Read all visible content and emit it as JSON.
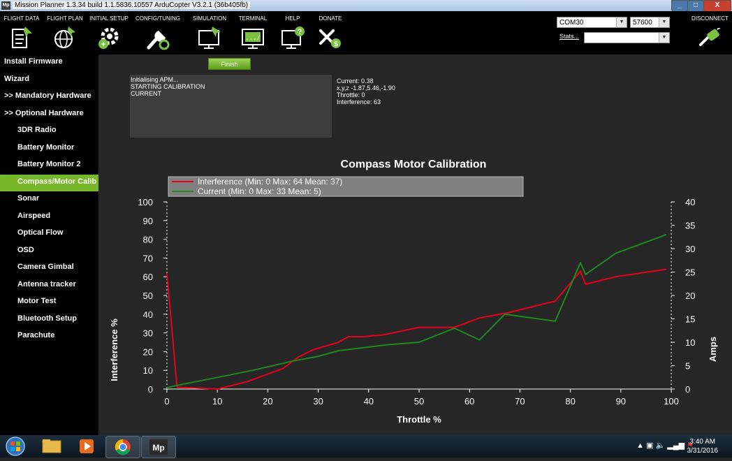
{
  "window": {
    "title": "Mission Planner 1.3.34 build 1.1.5836.10557 ArduCopter V3.2.1 (36b405fb)",
    "app_icon": "Mp"
  },
  "toolbar": {
    "items": [
      {
        "label": "FLIGHT DATA",
        "icon": "flight-data-icon"
      },
      {
        "label": "FLIGHT PLAN",
        "icon": "flight-plan-icon"
      },
      {
        "label": "INITIAL SETUP",
        "icon": "initial-setup-icon"
      },
      {
        "label": "CONFIG/TUNING",
        "icon": "config-tuning-icon"
      },
      {
        "label": "SIMULATION",
        "icon": "simulation-icon"
      },
      {
        "label": "TERMINAL",
        "icon": "terminal-icon"
      },
      {
        "label": "HELP",
        "icon": "help-icon"
      },
      {
        "label": "DONATE",
        "icon": "donate-icon"
      }
    ],
    "port": "COM30",
    "baud": "57600",
    "stats_link": "Stats...",
    "connect_label": "DISCONNECT"
  },
  "sidebar": {
    "items": [
      {
        "label": "Install Firmware"
      },
      {
        "label": "Wizard"
      },
      {
        "label": ">> Mandatory Hardware"
      },
      {
        "label": ">> Optional Hardware"
      },
      {
        "label": "3DR Radio"
      },
      {
        "label": "Battery Monitor"
      },
      {
        "label": "Battery Monitor 2"
      },
      {
        "label": "Compass/Motor Calib"
      },
      {
        "label": "Sonar"
      },
      {
        "label": "Airspeed"
      },
      {
        "label": "Optical Flow"
      },
      {
        "label": "OSD"
      },
      {
        "label": "Camera Gimbal"
      },
      {
        "label": "Antenna tracker"
      },
      {
        "label": "Motor Test"
      },
      {
        "label": "Bluetooth Setup"
      },
      {
        "label": "Parachute"
      }
    ],
    "active_index": 7
  },
  "calibration": {
    "finish_label": "Finish",
    "log_lines": [
      "Initialising APM...",
      "STARTING CALIBRATION",
      "CURRENT"
    ],
    "stats": {
      "current": "Current: 0.38",
      "xyz": "x,y,z -1.87,5.46,-1.90",
      "throttle": "Throttle: 0",
      "interference": "Interference: 63"
    }
  },
  "chart_data": {
    "type": "line",
    "title": "Compass Motor Calibration",
    "xlabel": "Throttle %",
    "ylabel": "Interference %",
    "y2label": "Amps",
    "xlim": [
      0,
      100
    ],
    "ylim": [
      0,
      100
    ],
    "y2lim": [
      0,
      40
    ],
    "xticks": [
      0,
      10,
      20,
      30,
      40,
      50,
      60,
      70,
      80,
      90,
      100
    ],
    "yticks": [
      0,
      10,
      20,
      30,
      40,
      50,
      60,
      70,
      80,
      90,
      100
    ],
    "y2ticks": [
      0,
      5,
      10,
      15,
      20,
      25,
      30,
      35,
      40
    ],
    "legend_position": "top-left",
    "series": [
      {
        "name": "Interference (Min: 0 Max: 64 Mean: 37)",
        "color": "#e8001c",
        "axis": "left",
        "x": [
          0,
          2,
          10,
          16,
          23,
          26,
          29,
          34,
          36,
          39,
          43,
          50,
          57,
          62,
          68,
          77,
          82,
          83,
          89,
          99
        ],
        "y": [
          62,
          1,
          0,
          4,
          11,
          17,
          21,
          25,
          28,
          28,
          29,
          33,
          33,
          38,
          41,
          47,
          63,
          56,
          60,
          64
        ]
      },
      {
        "name": "Current (Min: 0 Max: 33 Mean: 5)",
        "color": "#1f8a1f",
        "axis": "right",
        "x": [
          0,
          3,
          10,
          17,
          25,
          30,
          34,
          44,
          50,
          57,
          62,
          67,
          77,
          82,
          83,
          89,
          99
        ],
        "y": [
          0.3,
          1,
          2.5,
          4,
          6,
          7,
          8.2,
          9.5,
          10,
          13,
          10.5,
          16,
          14.5,
          27,
          24.5,
          29,
          33
        ]
      }
    ]
  },
  "taskbar": {
    "time": "3:40 AM",
    "date": "3/31/2016",
    "apps": [
      "windows-start-icon",
      "file-explorer-icon",
      "media-player-icon",
      "chrome-icon",
      "mission-planner-icon"
    ]
  }
}
